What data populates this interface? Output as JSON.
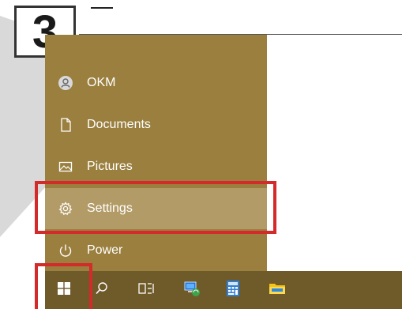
{
  "step": {
    "number": "3"
  },
  "start_menu": {
    "items": [
      {
        "label": "OKM",
        "icon": "user-avatar-icon"
      },
      {
        "label": "Documents",
        "icon": "document-icon"
      },
      {
        "label": "Pictures",
        "icon": "picture-icon"
      },
      {
        "label": "Settings",
        "icon": "gear-icon",
        "highlighted": true
      },
      {
        "label": "Power",
        "icon": "power-icon"
      }
    ]
  },
  "taskbar": {
    "items": [
      {
        "name": "start",
        "icon": "windows-logo-icon",
        "highlighted": true
      },
      {
        "name": "search",
        "icon": "search-icon"
      },
      {
        "name": "task-view",
        "icon": "task-view-icon"
      },
      {
        "name": "network-app",
        "icon": "network-app-icon"
      },
      {
        "name": "calculator",
        "icon": "calculator-icon"
      },
      {
        "name": "file-explorer",
        "icon": "folder-icon"
      }
    ]
  },
  "colors": {
    "menu_bg": "#9a7f3e",
    "menu_hover": "#b29b66",
    "taskbar_bg": "#6f5a2a",
    "highlight_border": "#d32a2a"
  }
}
